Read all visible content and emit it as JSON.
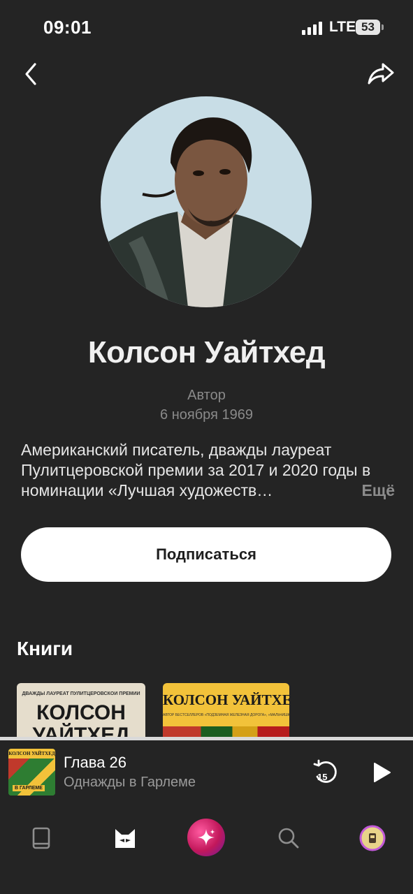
{
  "status_bar": {
    "time": "09:01",
    "network": "LTE",
    "battery": "53"
  },
  "nav": {
    "back_icon": "chevron-left-icon",
    "share_icon": "share-arrow-icon"
  },
  "author": {
    "name": "Колсон Уайтхед",
    "role": "Автор",
    "birth_date": "6 ноября 1969",
    "bio": "Американский писатель, дважды лауреат Пулитцеровской премии за 2017 и 2020 годы в номинации «Лучшая художеств…",
    "bio_more": "Ещё"
  },
  "subscribe_label": "Подписаться",
  "books_section": {
    "heading": "Книги",
    "books": [
      {
        "cover_tagline": "ДВАЖДЫ ЛАУРЕАТ ПУЛИТЦЕРОВСКОЙ ПРЕМИИ",
        "cover_author": "КОЛСОН УАЙТХЕД"
      },
      {
        "cover_author": "КОЛСОН УАЙТХЕД",
        "cover_tagline": "АВТОР БЕСТСЕЛЛЕРОВ «ПОДЗЕМНАЯ ЖЕЛЕЗНАЯ ДОРОГА», «МАЛЬЧИШКИ ИЗ «НИКЕЛЯ»"
      }
    ]
  },
  "now_playing": {
    "chapter": "Глава 26",
    "book": "Однажды в Гарлеме",
    "cover_author": "КОЛСОН УАЙТХЕД",
    "cover_subtitle": "В ГАРЛЕМЕ",
    "rewind_seconds": "15"
  },
  "tab_bar": {
    "items": [
      "library-icon",
      "bookmate-home-icon",
      "assistant-sparkle-icon",
      "search-icon",
      "profile-avatar-icon"
    ]
  },
  "colors": {
    "background": "#242424",
    "text_secondary": "#8a8a8a",
    "button_bg": "#ffffff"
  }
}
